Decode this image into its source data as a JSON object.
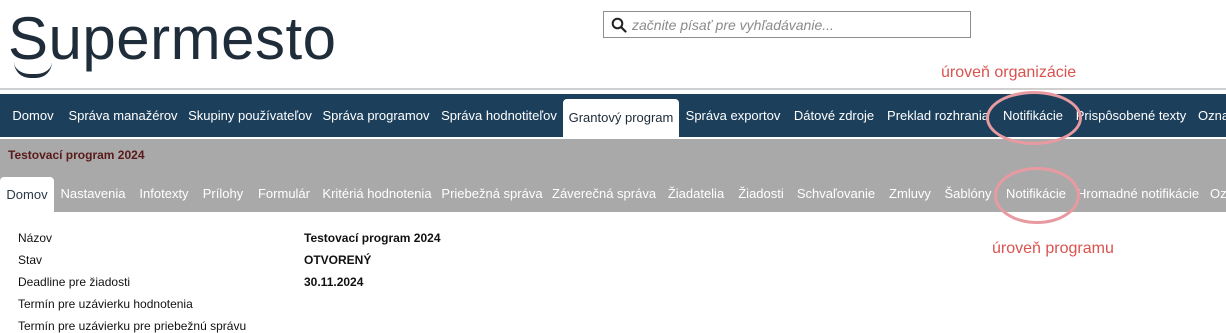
{
  "header": {
    "logo": "Supermesto",
    "search": {
      "placeholder": "začnite písať pre vyhľadávanie..."
    }
  },
  "annotations": {
    "organization_level": "úroveň organizácie",
    "program_level": "úroveň programu"
  },
  "main_nav": {
    "items": [
      {
        "label": "Domov"
      },
      {
        "label": "Správa manažérov"
      },
      {
        "label": "Skupiny používateľov"
      },
      {
        "label": "Správa programov"
      },
      {
        "label": "Správa hodnotiteľov"
      },
      {
        "label": "Grantový program",
        "active": true
      },
      {
        "label": "Správa exportov"
      },
      {
        "label": "Dátové zdroje"
      },
      {
        "label": "Preklad rozhrania"
      },
      {
        "label": "Notifikácie"
      },
      {
        "label": "Prispôsobené texty"
      },
      {
        "label": "Ozna"
      }
    ]
  },
  "program": {
    "title": "Testovací program 2024"
  },
  "sub_nav": {
    "items": [
      {
        "label": "Domov",
        "active": true
      },
      {
        "label": "Nastavenia"
      },
      {
        "label": "Infotexty"
      },
      {
        "label": "Prílohy"
      },
      {
        "label": "Formulár"
      },
      {
        "label": "Kritériá hodnotenia"
      },
      {
        "label": "Priebežná správa"
      },
      {
        "label": "Záverečná správa"
      },
      {
        "label": "Žiadatelia"
      },
      {
        "label": "Žiadosti"
      },
      {
        "label": "Schvaľovanie"
      },
      {
        "label": "Zmluvy"
      },
      {
        "label": "Šablóny"
      },
      {
        "label": "Notifikácie"
      },
      {
        "label": "Hromadné notifikácie"
      },
      {
        "label": "Oz"
      }
    ]
  },
  "details": [
    {
      "label": "Názov",
      "value": "Testovací program 2024"
    },
    {
      "label": "Stav",
      "value": "OTVORENÝ"
    },
    {
      "label": "Deadline pre žiadosti",
      "value": "30.11.2024"
    },
    {
      "label": "Termín pre uzávierku hodnotenia",
      "value": ""
    },
    {
      "label": "Termín pre uzávierku pre priebežnú správu",
      "value": ""
    }
  ],
  "colors": {
    "nav_bg": "#1c3f5c",
    "subnav_bg": "#a9a9a9",
    "annotation": "#d9534f"
  }
}
